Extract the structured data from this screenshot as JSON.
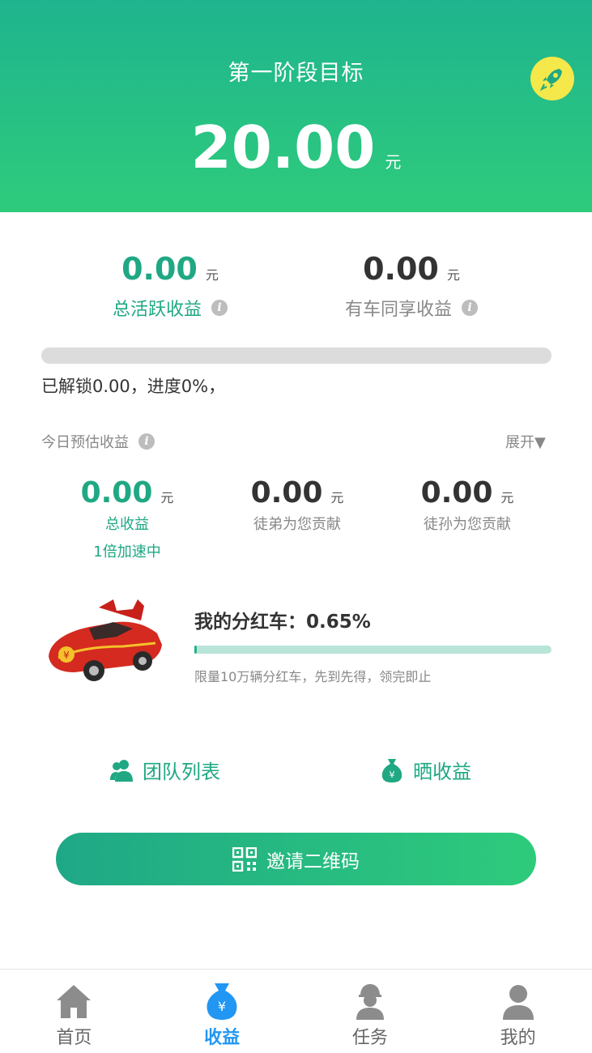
{
  "header": {
    "stage_title": "第一阶段目标",
    "stage_amount": "20.00",
    "unit": "元",
    "rocket_icon": "rocket-icon"
  },
  "earnings": {
    "total_active": {
      "value": "0.00",
      "unit": "元",
      "label": "总活跃收益"
    },
    "car_shared": {
      "value": "0.00",
      "unit": "元",
      "label": "有车同享收益"
    },
    "progress_percent": 0,
    "unlock_text": "已解锁0.00，进度0%，"
  },
  "today": {
    "label": "今日预估收益",
    "expand": "展开▼",
    "total": {
      "value": "0.00",
      "unit": "元",
      "label": "总收益",
      "boost": "1倍加速中"
    },
    "apprentice": {
      "value": "0.00",
      "unit": "元",
      "label": "徒弟为您贡献"
    },
    "grand_apprentice": {
      "value": "0.00",
      "unit": "元",
      "label": "徒孙为您贡献"
    }
  },
  "dividend_car": {
    "title": "我的分红车：0.65%",
    "percent": 0.65,
    "note": "限量10万辆分红车，先到先得，领完即止"
  },
  "actions": {
    "team_list": "团队列表",
    "share_earnings": "晒收益",
    "invite_qr": "邀请二维码"
  },
  "tabbar": [
    {
      "label": "首页",
      "icon": "home-icon",
      "active": false
    },
    {
      "label": "收益",
      "icon": "money-bag-icon",
      "active": true
    },
    {
      "label": "任务",
      "icon": "worker-icon",
      "active": false
    },
    {
      "label": "我的",
      "icon": "user-icon",
      "active": false
    }
  ],
  "colors": {
    "brand_green": "#1fb48e",
    "accent_blue": "#2196f3",
    "rocket_yellow": "#f4e84a"
  }
}
